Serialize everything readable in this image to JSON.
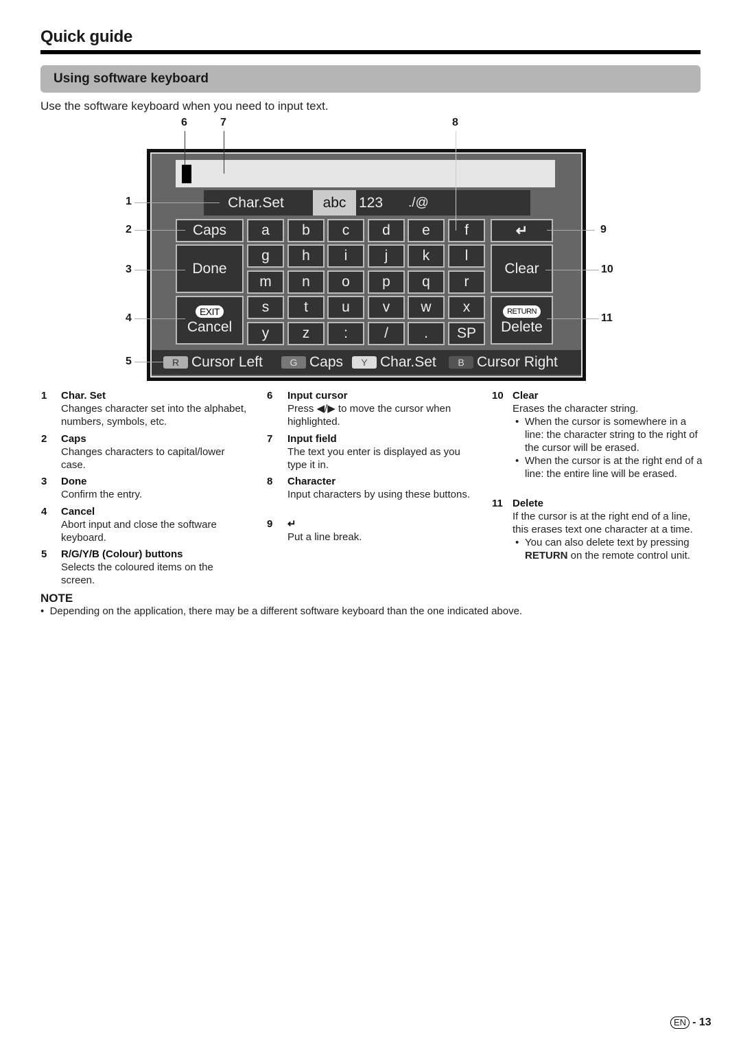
{
  "header": {
    "title": "Quick guide",
    "section_title": "Using software keyboard",
    "intro": "Use the software keyboard when you need to input text."
  },
  "keyboard": {
    "input_value": "",
    "charset": {
      "label": "Char.Set",
      "options": [
        "abc",
        "123",
        "./@"
      ],
      "selected": "abc"
    },
    "left_keys": {
      "caps": "Caps",
      "done": "Done",
      "cancel_badge": "EXIT",
      "cancel": "Cancel"
    },
    "char_rows": [
      [
        "a",
        "b",
        "c",
        "d",
        "e",
        "f"
      ],
      [
        "g",
        "h",
        "i",
        "j",
        "k",
        "l"
      ],
      [
        "m",
        "n",
        "o",
        "p",
        "q",
        "r"
      ],
      [
        "s",
        "t",
        "u",
        "v",
        "w",
        "x"
      ],
      [
        "y",
        "z",
        ":",
        "/",
        ".",
        "SP"
      ]
    ],
    "right_keys": {
      "enter_icon": "↵",
      "clear": "Clear",
      "delete_badge": "RETURN",
      "delete": "Delete"
    },
    "colour_bar": [
      {
        "key": "R",
        "label": "Cursor Left",
        "color": "#b0b0b0"
      },
      {
        "key": "G",
        "label": "Caps",
        "color": "#777777"
      },
      {
        "key": "Y",
        "label": "Char.Set",
        "color": "#dddddd"
      },
      {
        "key": "B",
        "label": "Cursor Right",
        "color": "#555555"
      }
    ]
  },
  "callouts": [
    "1",
    "2",
    "3",
    "4",
    "5",
    "6",
    "7",
    "8",
    "9",
    "10",
    "11"
  ],
  "descriptions": {
    "col1": [
      {
        "num": "1",
        "title": "Char. Set",
        "body": "Changes character set into the alphabet, numbers, symbols, etc."
      },
      {
        "num": "2",
        "title": "Caps",
        "body": "Changes characters to capital/lower case."
      },
      {
        "num": "3",
        "title": "Done",
        "body": "Confirm the entry."
      },
      {
        "num": "4",
        "title": "Cancel",
        "body": "Abort input and close the software keyboard."
      },
      {
        "num": "5",
        "title": "R/G/Y/B (Colour) buttons",
        "body": "Selects the coloured items on the screen."
      }
    ],
    "col2": [
      {
        "num": "6",
        "title": "Input cursor",
        "body": "Press ◀/▶ to move the cursor when highlighted."
      },
      {
        "num": "7",
        "title": "Input field",
        "body": "The text you enter is displayed as you type it in."
      },
      {
        "num": "8",
        "title": "Character",
        "body": "Input characters by using these buttons."
      },
      {
        "num": "9",
        "title": "↵",
        "body": "Put a line break."
      }
    ],
    "col3": [
      {
        "num": "10",
        "title": "Clear",
        "body": "Erases the character string.",
        "bullets": [
          "When the cursor is somewhere in a line: the character string to the right of the cursor will be erased.",
          "When the cursor is at the right end of a line: the entire line will be erased."
        ]
      },
      {
        "num": "11",
        "title": "Delete",
        "body": "If the cursor is at the right end of a line, this erases text one character at a time.",
        "bullets_rich": {
          "pre": "You can also delete text by pressing ",
          "bold": "RETURN",
          "post": " on the remote control unit."
        }
      }
    ]
  },
  "note": {
    "title": "NOTE",
    "items": [
      "Depending on the application, there may be a different software keyboard than the one indicated above."
    ]
  },
  "footer": {
    "lang_badge": "EN",
    "page": "13"
  }
}
